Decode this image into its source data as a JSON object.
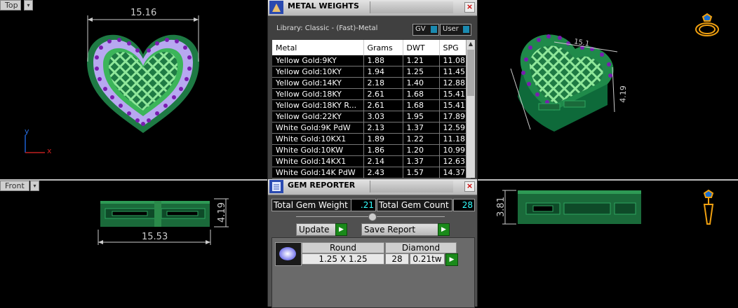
{
  "viewports": {
    "top": {
      "label": "Top",
      "dim_width": "15.16",
      "axis_y": "y",
      "axis_x": "x"
    },
    "front": {
      "label": "Front",
      "dim_width": "15.53",
      "dim_height": "4.19"
    },
    "perspective": {
      "dim_a": "15.1",
      "dim_b": "4.19"
    },
    "right": {
      "dim_height": "3.81"
    }
  },
  "metal_weights": {
    "title": "METAL WEIGHTS",
    "library": "Library: Classic - (Fast)-Metal",
    "gv_label": "GV",
    "user_label": "User",
    "columns": [
      "Metal",
      "Grams",
      "DWT",
      "SPG"
    ],
    "rows": [
      [
        "Yellow Gold:9KY",
        "1.88",
        "1.21",
        "11.08"
      ],
      [
        "Yellow Gold:10KY",
        "1.94",
        "1.25",
        "11.45"
      ],
      [
        "Yellow Gold:14KY",
        "2.18",
        "1.40",
        "12.88"
      ],
      [
        "Yellow Gold:18KY",
        "2.61",
        "1.68",
        "15.41"
      ],
      [
        "Yellow Gold:18KY R...",
        "2.61",
        "1.68",
        "15.41"
      ],
      [
        "Yellow Gold:22KY",
        "3.03",
        "1.95",
        "17.89"
      ],
      [
        "White Gold:9K PdW",
        "2.13",
        "1.37",
        "12.59"
      ],
      [
        "White Gold:10KX1",
        "1.89",
        "1.22",
        "11.18"
      ],
      [
        "White Gold:10KW",
        "1.86",
        "1.20",
        "10.99"
      ],
      [
        "White Gold:14KX1",
        "2.14",
        "1.37",
        "12.63"
      ],
      [
        "White Gold:14K PdW",
        "2.43",
        "1.57",
        "14.37"
      ]
    ],
    "close": "×"
  },
  "gem_reporter": {
    "title": "GEM REPORTER",
    "total_weight_label": "Total Gem Weight",
    "total_weight_value": ".21",
    "total_count_label": "Total Gem Count",
    "total_count_value": "28",
    "update_label": "Update",
    "save_label": "Save Report",
    "gem": {
      "shape": "Round",
      "type": "Diamond",
      "size": "1.25 X 1.25",
      "count": "28",
      "tw": "0.21tw"
    },
    "close": "×"
  }
}
